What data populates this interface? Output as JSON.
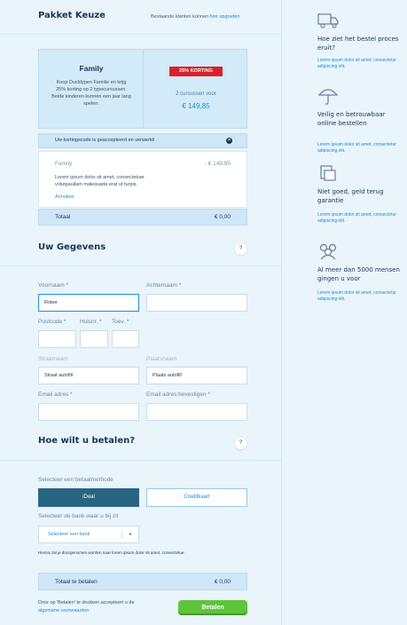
{
  "header": {
    "title": "Pakket Keuze",
    "existing_text": "Bestaande klanten kunnen",
    "upgrade_link": "hier upgraden"
  },
  "package": {
    "name": "Family",
    "description": "Koop Ducktypen Familie en krijg 25% korting op 2 typecursussen. Beide kinderen kunnen een jaar lang spelen.",
    "badge": "25% KORTING",
    "subtitle": "2 cursussen voor",
    "price": "€ 149,85"
  },
  "discount": {
    "message": "Uw kortingscode is geaccepteerd en verwerkt!"
  },
  "summary": {
    "item_name": "Family",
    "item_price": "- € 149,95",
    "text": "Lorem ipsum dolor sit amet, consectetuer volutpaullam malesuada erat ut turpis.",
    "cancel_link": "Annuleer",
    "total_label": "Totaal",
    "total_value": "€ 0,00"
  },
  "details": {
    "title": "Uw Gegevens",
    "help": "?",
    "voornaam_label": "Voornaam *",
    "voornaam_value": "Rober",
    "achternaam_label": "Achternaam *",
    "postcode_label": "Postcode *",
    "huisnr_label": "Huisnr. *",
    "toev_label": "Toev. *",
    "straat_label": "Straatnaam",
    "straat_value": "Straat autofill",
    "plaats_label": "Plaatsnaam",
    "plaats_value": "Plaats autofill",
    "email_label": "Email adres *",
    "email_confirm_label": "Email adres bevestigen *"
  },
  "payment": {
    "title": "Hoe wilt u betalen?",
    "help": "?",
    "method_label": "Selecteer een betaalmethode",
    "methods": [
      "iDeal",
      "Creditkaart"
    ],
    "bank_label": "Selecteer de bank waar u bij zit",
    "bank_placeholder": "Selecteer een bank",
    "note": "Hierna zal je doorgenomen worden naar lorem ipsum dolor sit amet, consectetue.",
    "total_label": "Totaal te betalen",
    "total_value": "€ 0,00",
    "terms_prefix": "Door op 'Betalen' te drukken accepteert u de",
    "terms_link": "algemene voorwaarden",
    "pay_button": "Betalen"
  },
  "sidebar": {
    "items": [
      {
        "icon": "truck-icon",
        "title": "Hoe ziet het bestel proces eruit?",
        "text": "Lorem ipsum dolor sit amet, consectetur adipiscing elit."
      },
      {
        "icon": "umbrella-icon",
        "title": "Veilig en betrouwbaar online bestellen",
        "text": "Lorem ipsum dolor sit amet, consectetur adipiscing elit."
      },
      {
        "icon": "box-icon",
        "title": "Niet goed, geld terug garantie",
        "text": "Lorem ipsum dolor sit amet, consectetur adipiscing elit."
      },
      {
        "icon": "people-icon",
        "title": "Al meer dan 5000 mensen gingen u voor",
        "text": "Lorem ipsum dolor sit amet, consectetur adipiscing elit."
      }
    ]
  },
  "colors": {
    "accent": "#1a8fd8",
    "pay_green": "#5fc43b",
    "badge_red": "#d9212b",
    "ideal_tab": "#27647f"
  }
}
